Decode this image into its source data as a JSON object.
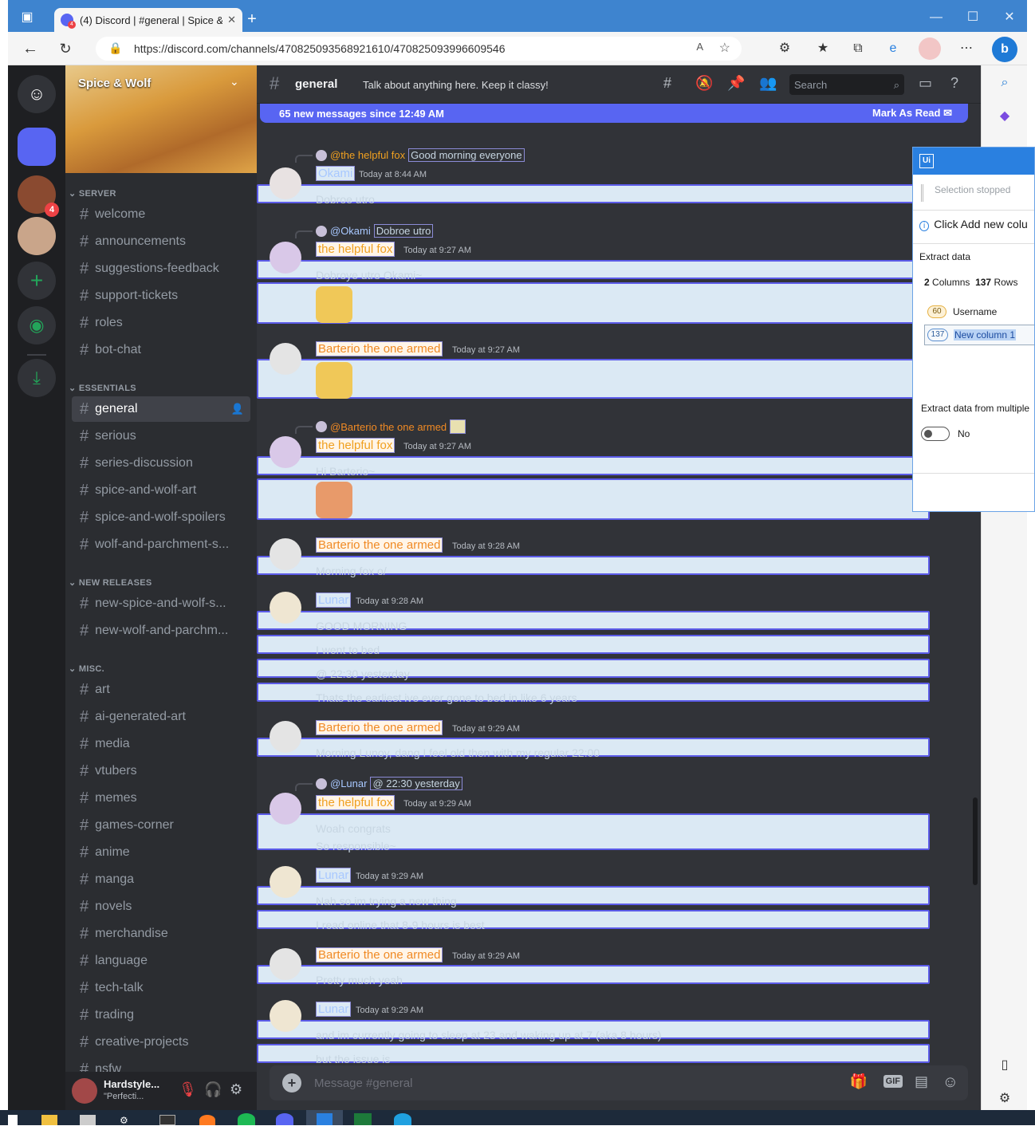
{
  "browser": {
    "tab_title": "(4) Discord | #general | Spice & W",
    "url": "https://discord.com/channels/470825093568921610/470825093996609546",
    "tab_badge": "4"
  },
  "server": {
    "name": "Spice & Wolf",
    "guild_badge": "4"
  },
  "categories": {
    "server": "SERVER",
    "essentials": "ESSENTIALS",
    "new_releases": "NEW RELEASES",
    "misc": "MISC."
  },
  "channels_server": [
    "welcome",
    "announcements",
    "suggestions-feedback",
    "support-tickets",
    "roles",
    "bot-chat"
  ],
  "channels_essentials": [
    "general",
    "serious",
    "series-discussion",
    "spice-and-wolf-art",
    "spice-and-wolf-spoilers",
    "wolf-and-parchment-s..."
  ],
  "channels_new": [
    "new-spice-and-wolf-s...",
    "new-wolf-and-parchm..."
  ],
  "channels_misc": [
    "art",
    "ai-generated-art",
    "media",
    "vtubers",
    "memes",
    "games-corner",
    "anime",
    "manga",
    "novels",
    "merchandise",
    "language",
    "tech-talk",
    "trading",
    "creative-projects",
    "nsfw"
  ],
  "user": {
    "name": "Hardstyle...",
    "status": "\"Perfecti..."
  },
  "chat": {
    "channel": "general",
    "topic": "Talk about anything here. Keep it classy!",
    "search_placeholder": "Search",
    "new_messages": "65 new messages since 12:49 AM",
    "mark_read": "Mark As Read",
    "composer_placeholder": "Message #general"
  },
  "messages": {
    "m1": {
      "reply_user": "@the helpful fox",
      "reply_text": "Good morning everyone",
      "user": "Okami",
      "time": "Today at 8:44 AM",
      "lines": [
        "Dobroe utro"
      ]
    },
    "m2": {
      "reply_user": "@Okami",
      "reply_text": "Dobroe utro",
      "user": "the helpful fox",
      "time": "Today at 9:27 AM",
      "lines": [
        "Dobroye utro Okami~"
      ]
    },
    "m3": {
      "user": "Barterio the one armed",
      "time": "Today at 9:27 AM"
    },
    "m4": {
      "reply_user": "@Barterio the one armed",
      "user": "the helpful fox",
      "time": "Today at 9:27 AM",
      "lines": [
        "Hi Barterio~"
      ]
    },
    "m5": {
      "user": "Barterio the one armed",
      "time": "Today at 9:28 AM",
      "lines": [
        "Morning fox o/"
      ]
    },
    "m6": {
      "user": "Lunar",
      "time": "Today at 9:28 AM",
      "lines": [
        "GOOD MORNING",
        "I went to bed",
        "@ 22:30 yesterday",
        "Thats the earliest ive ever gone to bed in like 6 years"
      ]
    },
    "m7": {
      "user": "Barterio the one armed",
      "time": "Today at 9:29 AM",
      "lines": [
        "Morning Lunoy, dang I feel old then with my regular 22:00"
      ]
    },
    "m8": {
      "reply_user": "@Lunar",
      "reply_text": "@ 22:30 yesterday",
      "user": "the helpful fox",
      "time": "Today at 9:29 AM",
      "lines": [
        "Woah congrats",
        "So responsible~"
      ]
    },
    "m9": {
      "user": "Lunar",
      "time": "Today at 9:29 AM",
      "lines": [
        "Nah so im trying a new thing",
        "I read online that 8-9 hours is best"
      ]
    },
    "m10": {
      "user": "Barterio the one armed",
      "time": "Today at 9:29 AM",
      "lines": [
        "Pretty much yeah"
      ]
    },
    "m11": {
      "user": "Lunar",
      "time": "Today at 9:29 AM",
      "lines": [
        "and im currently going to sleep at 23 and waking up at 7 (aka 8 hours)",
        "but the issue is"
      ]
    }
  },
  "uipath": {
    "selection": "Selection stopped",
    "hint": "Click Add new colu",
    "title": "Extract data",
    "columns_label": "Columns",
    "columns": "2",
    "rows_label": "Rows",
    "rows": "137",
    "col1_count": "60",
    "col1_name": "Username",
    "col2_count": "137",
    "col2_name": "New column 1",
    "multi": "Extract data from multiple",
    "toggle": "No"
  },
  "colors": {
    "accent": "#5865f2",
    "highlight": "#dbe9f4",
    "outline": "#5b5be8",
    "fox": "#f0a020",
    "barterio": "#f08a24",
    "lunar": "#a8c8ff"
  }
}
